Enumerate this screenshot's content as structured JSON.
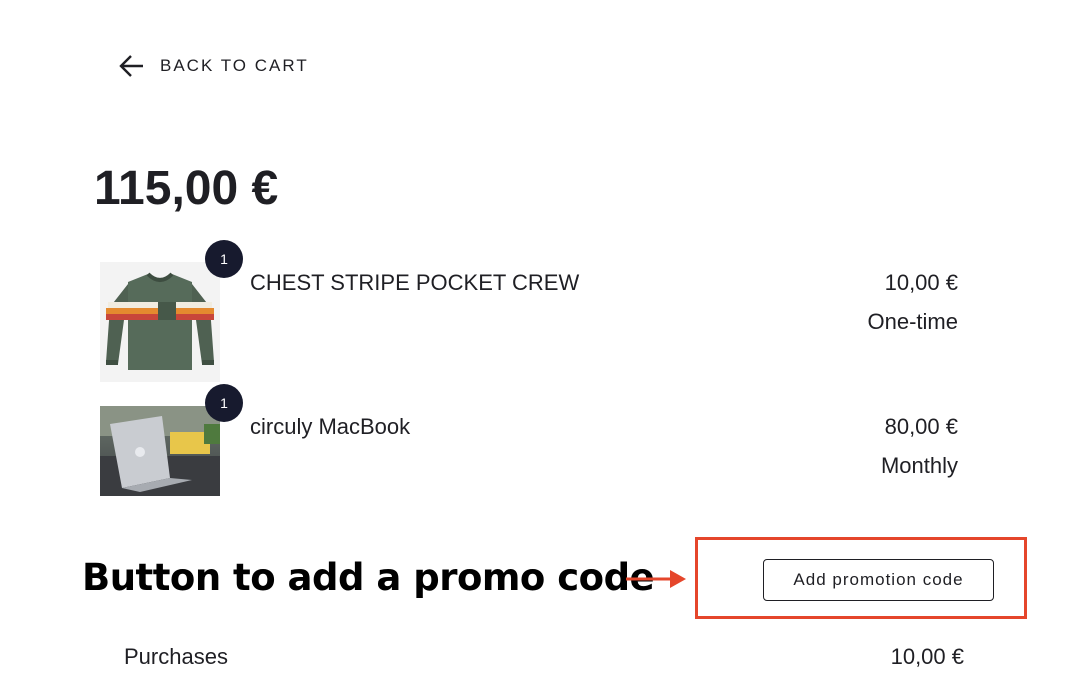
{
  "nav": {
    "back_label": "BACK TO CART",
    "back_icon": "arrow-left-icon"
  },
  "order": {
    "total": "115,00 €"
  },
  "items": [
    {
      "qty": "1",
      "name": "CHEST STRIPE POCKET CREW",
      "price": "10,00 €",
      "frequency": "One-time",
      "image": "green-striped-sweater"
    },
    {
      "qty": "1",
      "name": "circuly MacBook",
      "price": "80,00 €",
      "frequency": "Monthly",
      "image": "macbook-on-desk"
    }
  ],
  "annotation": {
    "text": "Button to add a promo code",
    "color": "#e5462b"
  },
  "promo": {
    "button_label": "Add promotion code"
  },
  "summary": {
    "purchases_label": "Purchases",
    "purchases_value": "10,00 €"
  }
}
